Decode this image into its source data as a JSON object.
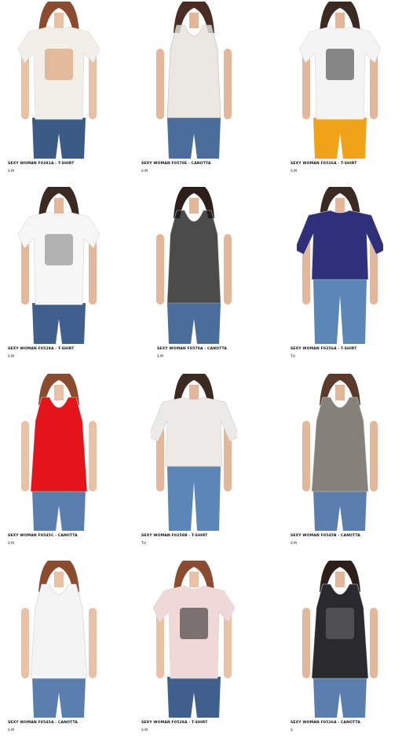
{
  "products": [
    {
      "title": "SEXY WOMAN  F0281A - T-SHIRT",
      "sizes": "S  M",
      "colors": {
        "top": "#f2efe9",
        "bottom": "#3b5a86",
        "print": "#d98f5a",
        "hair": "#8a4b2f",
        "skin": "#e9c2a6"
      },
      "style": "tee",
      "print_icon": "buddha-print"
    },
    {
      "title": "SEXY WOMAN  F0570E - CANOTTA",
      "sizes": "S  M",
      "colors": {
        "top": "#e6e2dd",
        "bottom": "#4a6d99",
        "print": "#d7d2cb",
        "hair": "#4a2d22",
        "skin": "#e2b79a"
      },
      "style": "tank-mesh",
      "print_icon": ""
    },
    {
      "title": "SEXY WOMAN  F0526A - T-SHIRT",
      "sizes": "S  M",
      "colors": {
        "top": "#f4f4f4",
        "bottom": "#f0a318",
        "print": "#2b2b2b",
        "hair": "#3b2a22",
        "skin": "#e5b79a"
      },
      "style": "tee",
      "print_icon": "ace-card-print"
    },
    {
      "title": "SEXY WOMAN  F0529A - T-SHIRT",
      "sizes": "S  M",
      "colors": {
        "top": "#f6f6f6",
        "bottom": "#3f5f8d",
        "print": "#7a7a7a",
        "hair": "#3b2a22",
        "skin": "#e5b79a"
      },
      "style": "tee",
      "print_icon": "sexy-woman-print"
    },
    {
      "title": "SEXY WOMAN  F0570A - CANOTTA",
      "sizes": "S  M",
      "colors": {
        "top": "#1e1e1e",
        "bottom": "#4a6d99",
        "print": "#2d2d2d",
        "hair": "#2c1f1a",
        "skin": "#e2b79a"
      },
      "style": "tank-mesh",
      "print_icon": ""
    },
    {
      "title": "SEXY WOMAN  F0256A - T-SHIRT",
      "sizes": "TU",
      "colors": {
        "top": "#2f2f7a",
        "bottom": "#5b86b5",
        "print": "#3a3a86",
        "hair": "#3b2a22",
        "skin": "#e5b79a"
      },
      "style": "crop",
      "print_icon": ""
    },
    {
      "title": "SEXY WOMAN  F0545C - CANOTTA",
      "sizes": "S  M",
      "colors": {
        "top": "#e3141a",
        "bottom": "#5a7fae",
        "print": "#d01015",
        "hair": "#8a4b2f",
        "skin": "#e9c2a6"
      },
      "style": "tank",
      "print_icon": ""
    },
    {
      "title": "SEXY WOMAN  F0258B - T-SHIRT",
      "sizes": "TU",
      "colors": {
        "top": "#eceae6",
        "bottom": "#5b86b5",
        "print": "#dcd8d2",
        "hair": "#3b2a22",
        "skin": "#e5b79a"
      },
      "style": "crop",
      "print_icon": ""
    },
    {
      "title": "SEXY WOMAN  F0545B - CANOTTA",
      "sizes": "S  M",
      "colors": {
        "top": "#86807a",
        "bottom": "#5a7fae",
        "print": "#7a746e",
        "hair": "#5a3a2a",
        "skin": "#e2b79a"
      },
      "style": "tank",
      "print_icon": ""
    },
    {
      "title": "SEXY WOMAN  F0545A - CANOTTA",
      "sizes": "S  M",
      "colors": {
        "top": "#f4f4f4",
        "bottom": "#5a7fae",
        "print": "#eeeeee",
        "hair": "#8a4b2f",
        "skin": "#e9c2a6"
      },
      "style": "tank",
      "print_icon": ""
    },
    {
      "title": "SEXY WOMAN  F0528A - T-SHIRT",
      "sizes": "S  M",
      "colors": {
        "top": "#f0d8d8",
        "bottom": "#3f5f8d",
        "print": "#1e1e1e",
        "hair": "#8a4b2f",
        "skin": "#e9c2a6"
      },
      "style": "tee",
      "print_icon": "free-wandering-gypsy-print"
    },
    {
      "title": "SEXY WOMAN  F0526A - CANOTTA",
      "sizes": "S",
      "colors": {
        "top": "#2a2a2e",
        "bottom": "#5a7fae",
        "print": "#6f6f74",
        "hair": "#2c1f1a",
        "skin": "#e2b79a"
      },
      "style": "tank",
      "print_icon": "tie-dye-print"
    }
  ]
}
